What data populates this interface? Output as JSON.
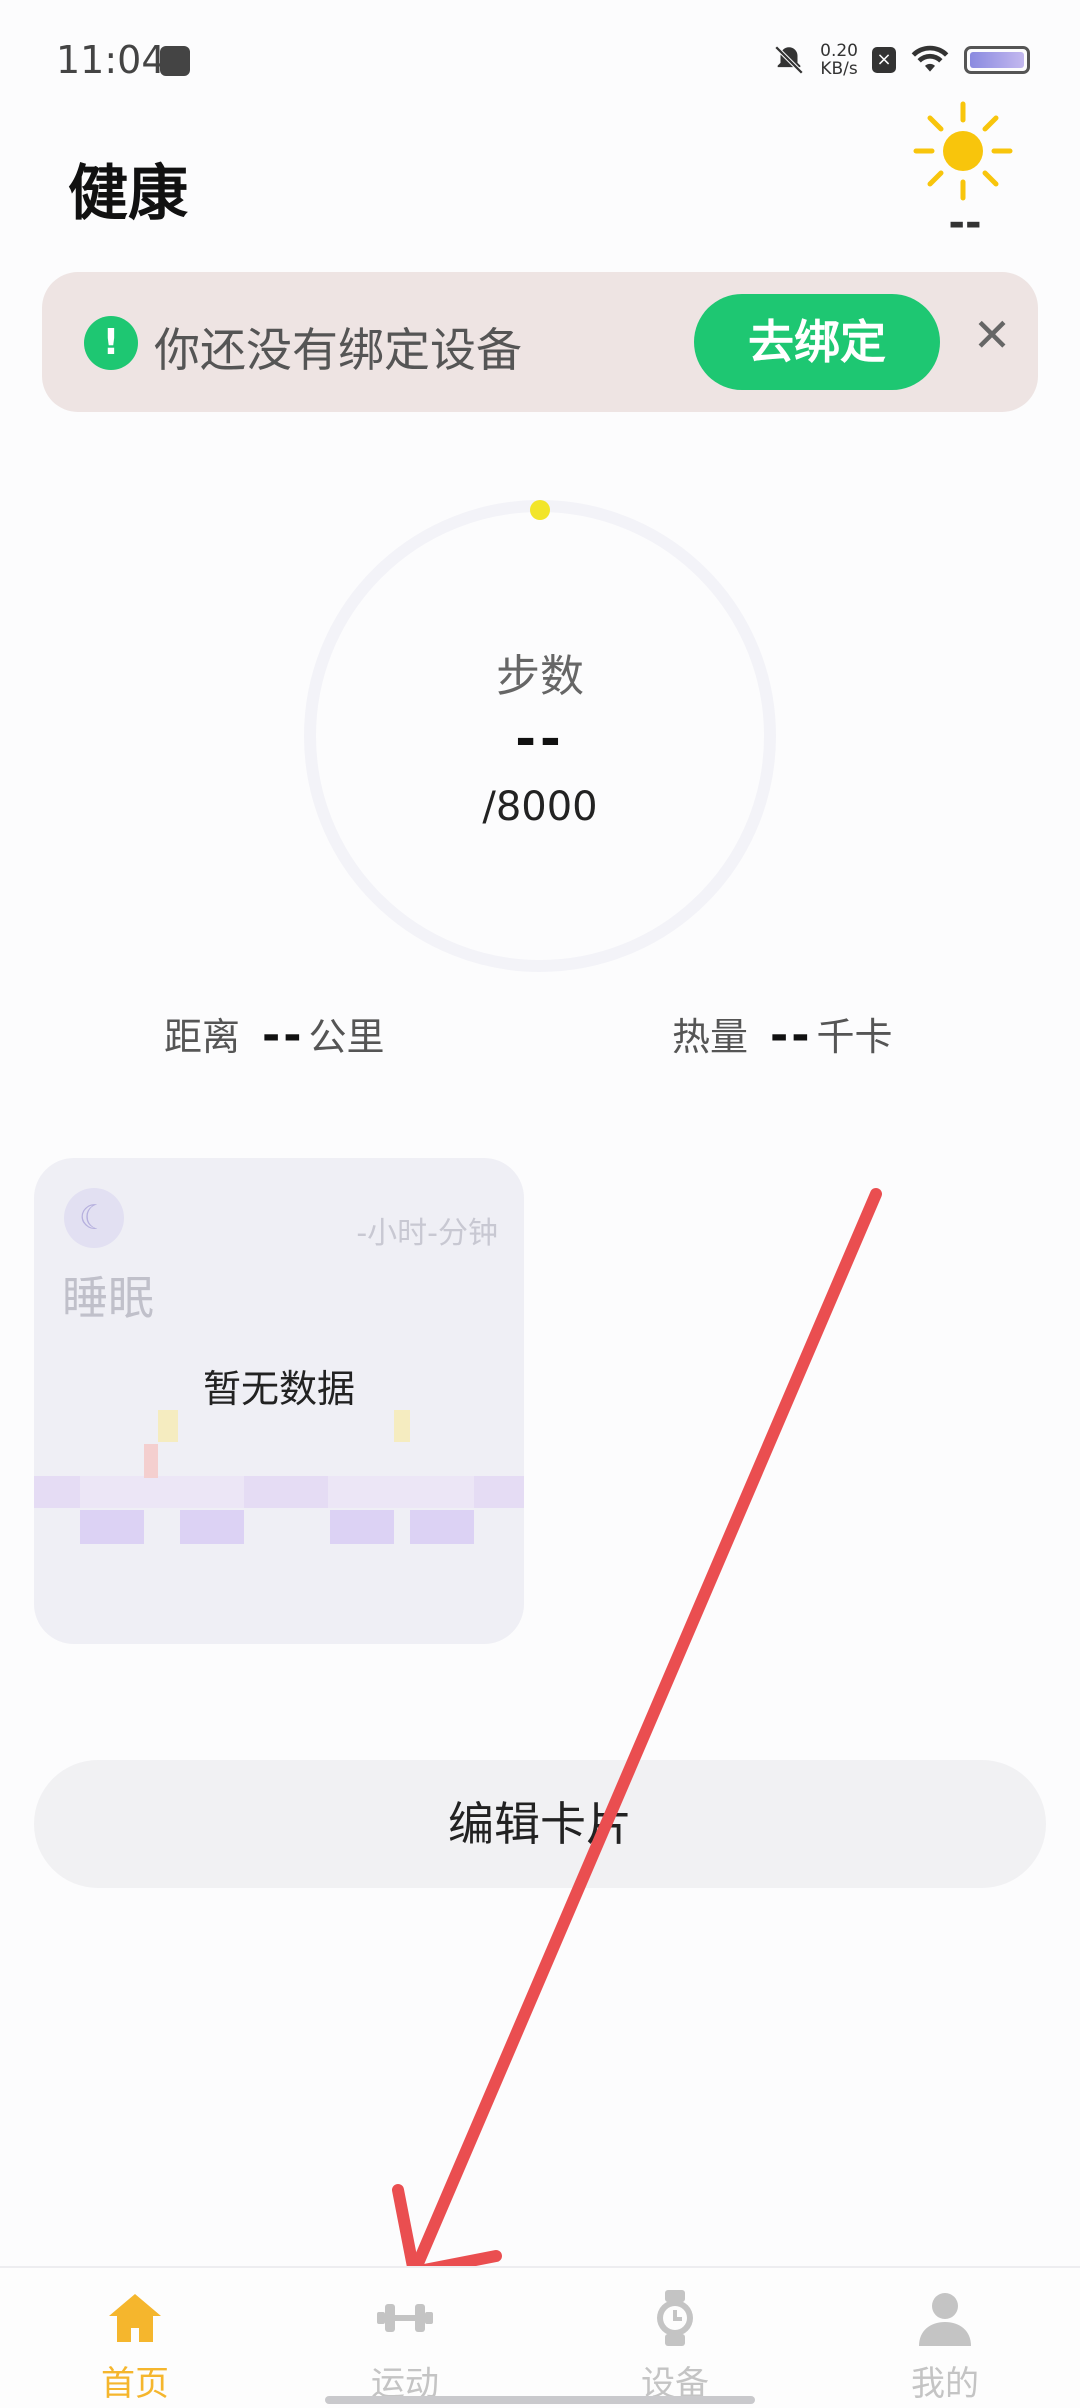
{
  "status_bar": {
    "time": "11:04",
    "speed_value": "0.20",
    "speed_unit": "KB/s"
  },
  "header": {
    "title": "健康",
    "weather_icon": "sun-icon",
    "weather_temp": "--"
  },
  "bind_banner": {
    "message": "你还没有绑定设备",
    "button_label": "去绑定",
    "close_glyph": "✕",
    "accent_color": "#1ec772"
  },
  "steps": {
    "label": "步数",
    "value": "--",
    "goal": "/8000"
  },
  "metrics": {
    "distance": {
      "label": "距离",
      "value": "--",
      "unit": "公里"
    },
    "calories": {
      "label": "热量",
      "value": "--",
      "unit": "千卡"
    }
  },
  "sleep_card": {
    "icon": "moon-icon",
    "duration": "-小时-分钟",
    "title": "睡眠",
    "empty_text": "暂无数据"
  },
  "edit_cards": {
    "label": "编辑卡片"
  },
  "bottom_nav": {
    "active_color": "#f5b62d",
    "items": [
      {
        "label": "首页",
        "icon": "home-icon"
      },
      {
        "label": "运动",
        "icon": "dumbbell-icon"
      },
      {
        "label": "设备",
        "icon": "watch-icon"
      },
      {
        "label": "我的",
        "icon": "person-icon"
      }
    ]
  }
}
